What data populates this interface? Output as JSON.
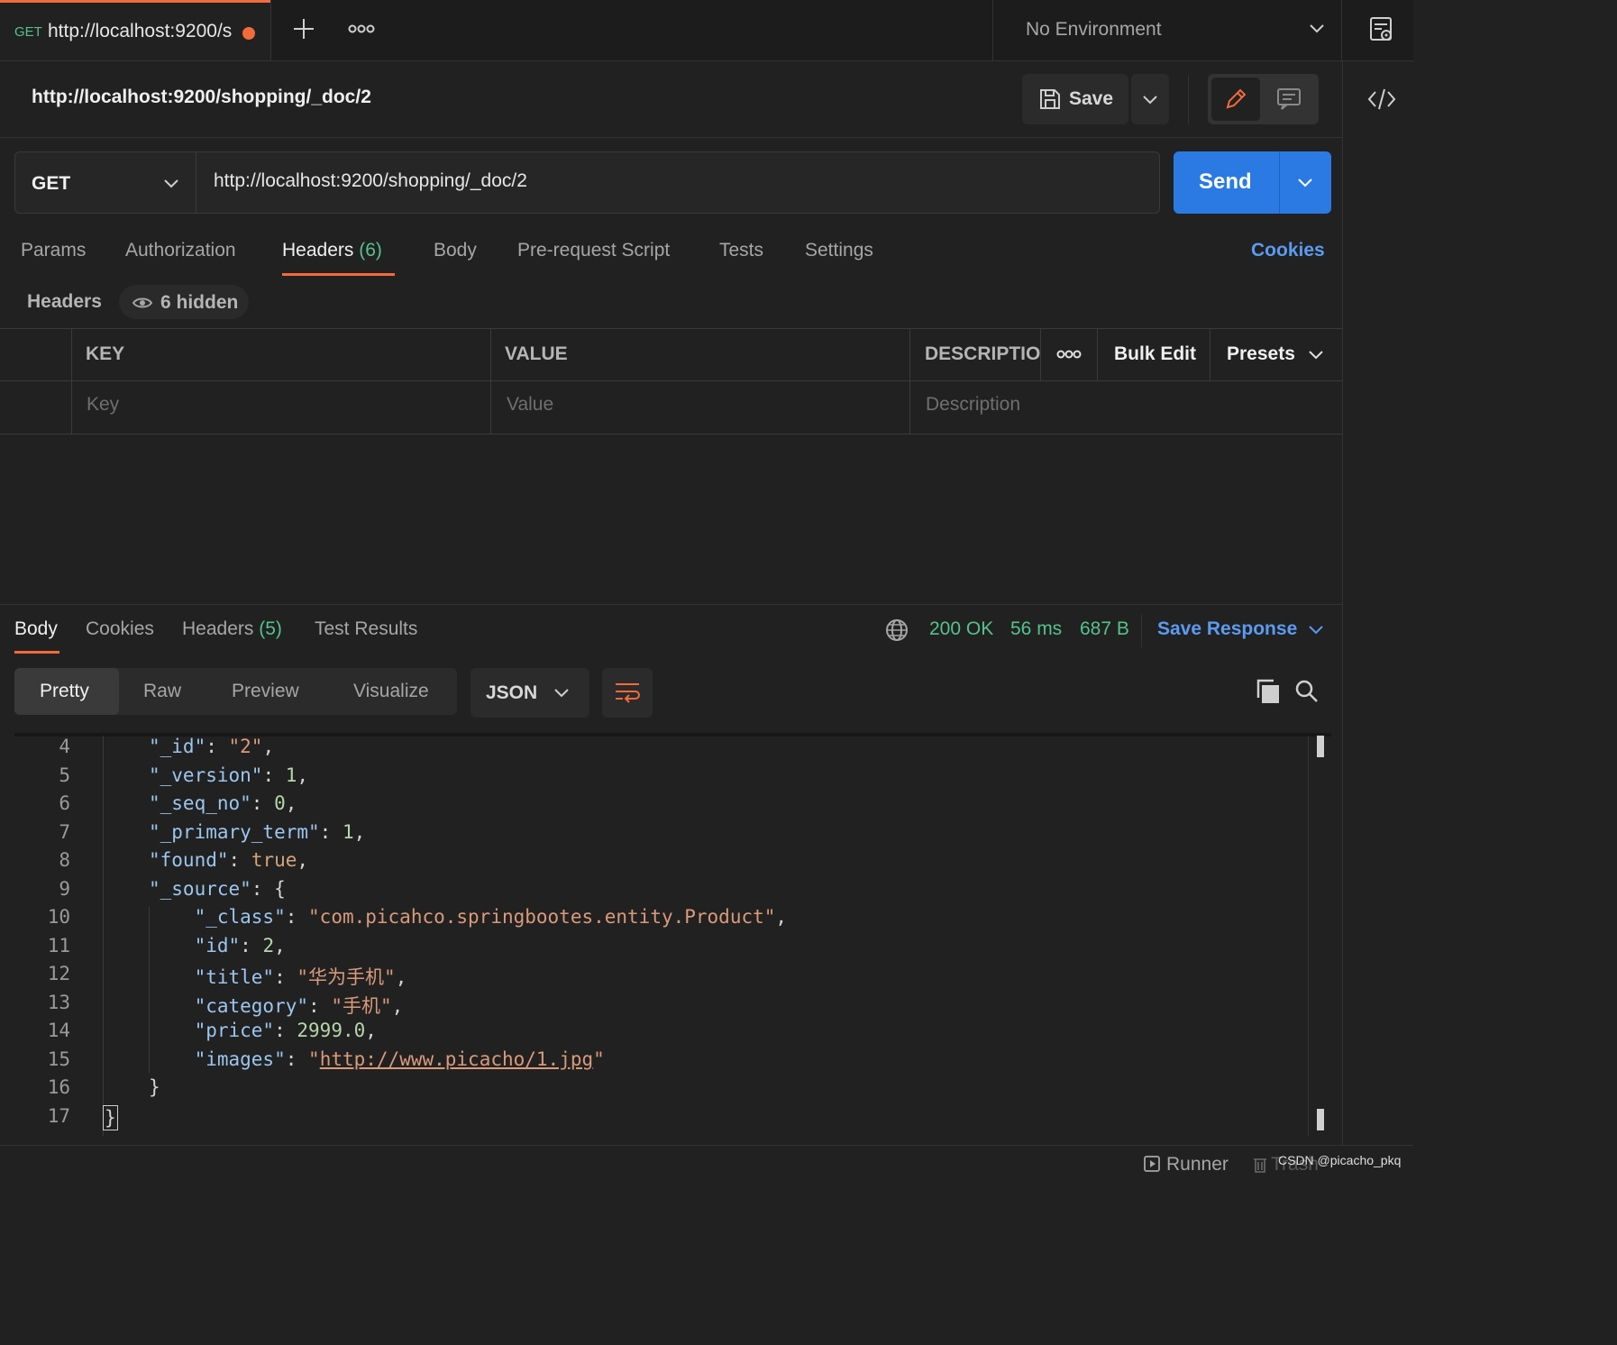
{
  "tab": {
    "method": "GET",
    "title": "http://localhost:9200/s"
  },
  "environment": {
    "label": "No Environment"
  },
  "request": {
    "name": "http://localhost:9200/shopping/_doc/2",
    "save_label": "Save",
    "method": "GET",
    "url": "http://localhost:9200/shopping/_doc/2",
    "send_label": "Send"
  },
  "request_tabs": {
    "params": "Params",
    "authorization": "Authorization",
    "headers": "Headers",
    "headers_count": "(6)",
    "body": "Body",
    "pre_request": "Pre-request Script",
    "tests": "Tests",
    "settings": "Settings",
    "cookies": "Cookies"
  },
  "headers_section": {
    "title": "Headers",
    "hidden": "6 hidden",
    "col_key": "KEY",
    "col_value": "VALUE",
    "col_description": "DESCRIPTIO",
    "bulk_edit": "Bulk Edit",
    "presets": "Presets",
    "key_placeholder": "Key",
    "value_placeholder": "Value",
    "description_placeholder": "Description"
  },
  "response_tabs": {
    "body": "Body",
    "cookies": "Cookies",
    "headers": "Headers",
    "headers_count": "(5)",
    "test_results": "Test Results"
  },
  "response_status": {
    "status": "200 OK",
    "time": "56 ms",
    "size": "687 B",
    "save_response": "Save Response"
  },
  "view_modes": {
    "pretty": "Pretty",
    "raw": "Raw",
    "preview": "Preview",
    "visualize": "Visualize",
    "format": "JSON"
  },
  "code_lines": [
    {
      "n": "4"
    },
    {
      "n": "5"
    },
    {
      "n": "6"
    },
    {
      "n": "7"
    },
    {
      "n": "8"
    },
    {
      "n": "9"
    },
    {
      "n": "10"
    },
    {
      "n": "11"
    },
    {
      "n": "12"
    },
    {
      "n": "13"
    },
    {
      "n": "14"
    },
    {
      "n": "15"
    },
    {
      "n": "16"
    },
    {
      "n": "17"
    }
  ],
  "code": {
    "id_key": "\"_id\"",
    "id_val": "\"2\"",
    "version_key": "\"_version\"",
    "version_val": "1",
    "seq_key": "\"_seq_no\"",
    "seq_val": "0",
    "term_key": "\"_primary_term\"",
    "term_val": "1",
    "found_key": "\"found\"",
    "found_val": "true",
    "source_key": "\"_source\"",
    "class_key": "\"_class\"",
    "class_val": "\"com.picahco.springbootes.entity.Product\"",
    "sid_key": "\"id\"",
    "sid_val": "2",
    "title_key": "\"title\"",
    "title_val": "\"华为手机\"",
    "cat_key": "\"category\"",
    "cat_val": "\"手机\"",
    "price_key": "\"price\"",
    "price_val": "2999.0",
    "img_key": "\"images\"",
    "img_val": "http://www.picacho/1.jpg"
  },
  "footer": {
    "runner": "Runner",
    "trash": "Trash",
    "watermark": "CSDN @picacho_pkq"
  }
}
